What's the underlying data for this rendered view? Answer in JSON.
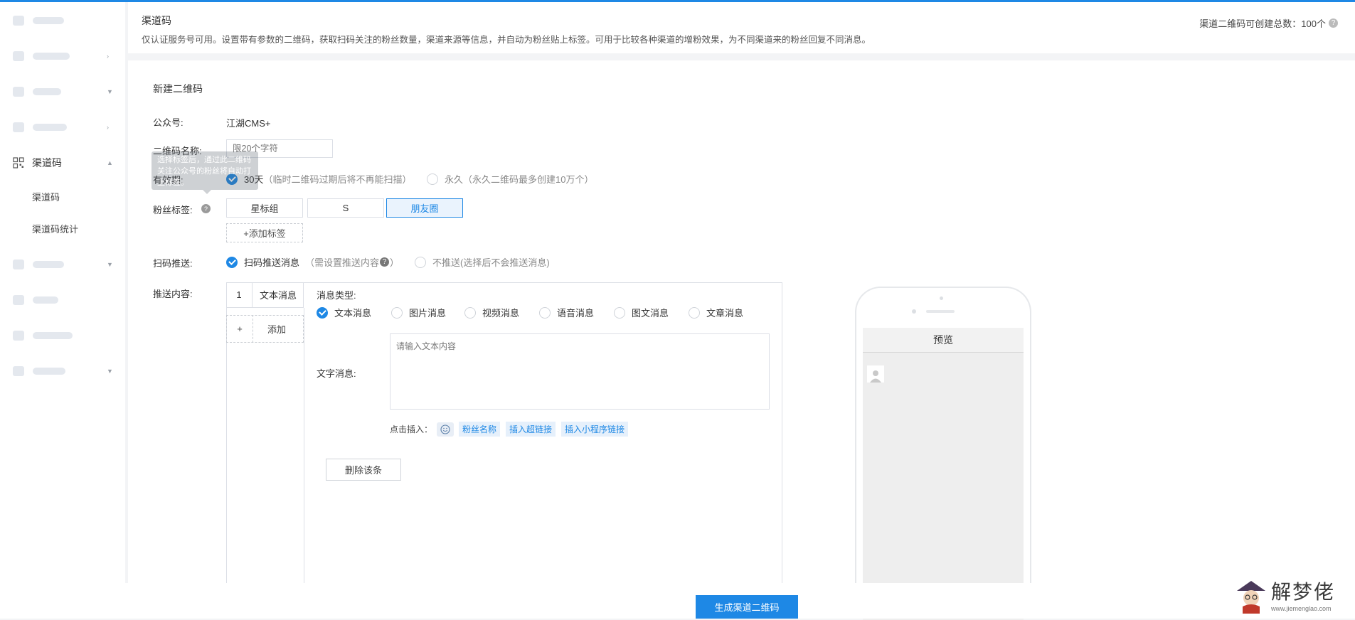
{
  "header": {
    "title": "渠道码",
    "description": "仅认证服务号可用。设置带有参数的二维码，获取扫码关注的粉丝数量，渠道来源等信息，并自动为粉丝贴上标签。可用于比较各种渠道的增粉效果，为不同渠道来的粉丝回复不同消息。",
    "quota_text": "渠道二维码可创建总数：100个",
    "help": "?"
  },
  "sidebar": {
    "active_group": "渠道码",
    "subitems": [
      "渠道码",
      "渠道码统计"
    ]
  },
  "form": {
    "card_title": "新建二维码",
    "account_label": "公众号:",
    "account_value": "江湖CMS+",
    "name_label": "二维码名称:",
    "name_placeholder": "限20个字符",
    "validity_label": "有效期:",
    "validity_option1": "30天",
    "validity_option1_hint": "（临时二维码过期后将不再能扫描）",
    "validity_option2": "永久",
    "validity_option2_hint": "（永久二维码最多创建10万个）",
    "tag_label": "粉丝标签:",
    "tags": [
      "星标组",
      "S",
      "朋友圈"
    ],
    "add_tag": "+添加标签",
    "tooltip": "选择标签后，通过此二维码关注公众号的粉丝将自动打上标签。",
    "scan_push_label": "扫码推送:",
    "push_option1": "扫码推送消息",
    "push_option1_hint": "（需设置推送内容",
    "push_option1_close": "）",
    "push_option2": "不推送",
    "push_option2_hint": "(选择后不会推送消息)",
    "content_label": "推送内容:",
    "message_tab_num": "1",
    "message_tab_name": "文本消息",
    "add_plus": "+",
    "add_label": "添加",
    "msg_type_label": "消息类型:",
    "msg_types": [
      "文本消息",
      "图片消息",
      "视频消息",
      "语音消息",
      "图文消息",
      "文章消息"
    ],
    "text_msg_label": "文字消息:",
    "text_placeholder": "请输入文本内容",
    "insert_label": "点击插入：",
    "insert_chips": [
      "粉丝名称",
      "插入超链接",
      "插入小程序链接"
    ],
    "delete_button": "删除该条"
  },
  "preview": {
    "title": "预览"
  },
  "footer": {
    "generate_button": "生成渠道二维码"
  },
  "watermark": {
    "text": "解梦佬",
    "url": "www.jiemenglao.com"
  },
  "colors": {
    "primary": "#1e88e5",
    "border": "#dcdfe6"
  }
}
